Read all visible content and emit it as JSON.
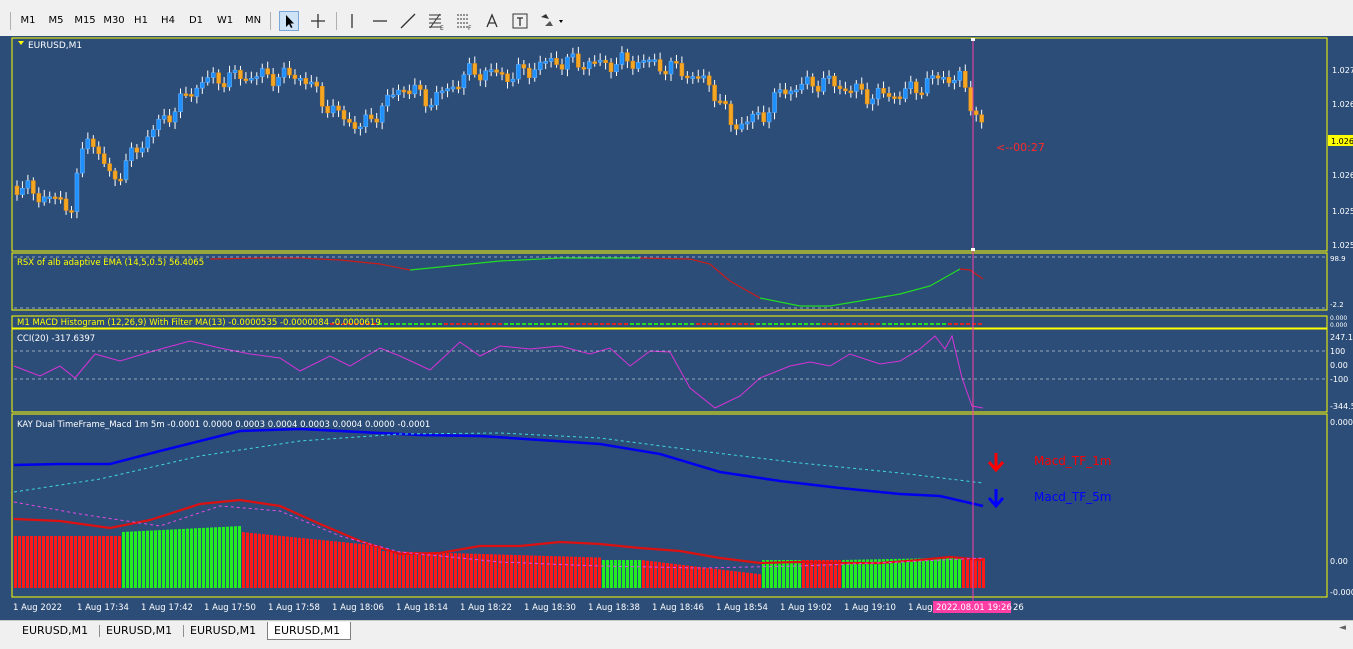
{
  "toolbar": {
    "timeframes": [
      "M1",
      "M5",
      "M15",
      "M30",
      "H1",
      "H4",
      "D1",
      "W1",
      "MN"
    ],
    "tools": [
      "cursor-icon",
      "crosshair-icon",
      "vertical-line-icon",
      "horizontal-line-icon",
      "trendline-icon",
      "fibonacci-icon",
      "fibo-fan-icon",
      "text-icon",
      "label-icon",
      "shapes-icon"
    ]
  },
  "chart": {
    "symbol_label": "EURUSD,M1",
    "price_axis": [
      "1.027",
      "1.026",
      "1.026",
      "1.026",
      "1.025",
      "1.025"
    ],
    "current_price": "1.026",
    "countdown": "<--00:27",
    "time_axis": [
      "1 Aug 2022",
      "1 Aug 17:34",
      "1 Aug 17:42",
      "1 Aug 17:50",
      "1 Aug 17:58",
      "1 Aug 18:06",
      "1 Aug 18:14",
      "1 Aug 18:22",
      "1 Aug 18:30",
      "1 Aug 18:38",
      "1 Aug 18:46",
      "1 Aug 18:54",
      "1 Aug 19:02",
      "1 Aug 19:10",
      "1 Aug"
    ],
    "time_tail": "26",
    "cursor_time": "2022.08.01 19:26",
    "colors": {
      "background": "#2c4d78",
      "bull": "#1e90ff",
      "bear": "#f5a623",
      "border": "#ffff00",
      "cursor": "#ff3ea5"
    }
  },
  "indicators": {
    "rsx": {
      "label": "RSX of alb adaptive EMA (14,5,0.5) 56.4065",
      "axis_top": "98.9",
      "axis_bottom": "-2.2"
    },
    "macd_hist": {
      "label": "M1 MACD Histogram (12,26,9) With Filter MA(13) -0.0000535 -0.0000084 -0.0000619",
      "axis_values": [
        "0.000",
        "0.000",
        "0.000"
      ]
    },
    "cci": {
      "label": "CCI(20) -317.6397",
      "axis": [
        "247.1",
        "100",
        "0.00",
        "-100",
        "-344.5"
      ]
    },
    "kay": {
      "label": "KAY Dual TimeFrame_Macd 1m 5m  -0.0001 0.0000 0.0003 0.0004 0.0003 0.0004 0.0000 -0.0001",
      "axis": [
        "0.000",
        "0.00",
        "-0.000"
      ],
      "legend_1m": "Macd_TF_1m",
      "legend_5m": "Macd_TF_5m",
      "color_1m": "#ff0000",
      "color_5m": "#0000ff"
    }
  },
  "tabs": [
    {
      "label": "EURUSD,M1",
      "active": false
    },
    {
      "label": "EURUSD,M1",
      "active": false
    },
    {
      "label": "EURUSD,M1",
      "active": false
    },
    {
      "label": "EURUSD,M1",
      "active": true
    }
  ],
  "tabs_scroll": {
    "left": "◄",
    "right": "►"
  }
}
